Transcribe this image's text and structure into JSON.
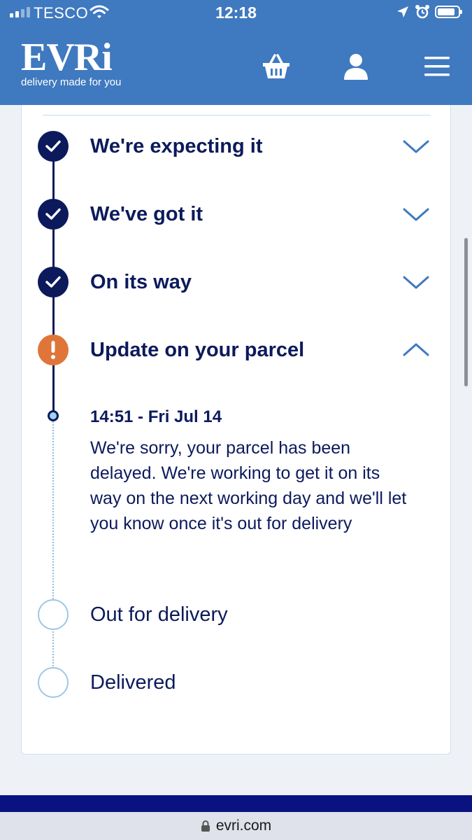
{
  "status_bar": {
    "carrier": "TESCO",
    "time": "12:18"
  },
  "header": {
    "logo": "EVRi",
    "tagline": "delivery made for you",
    "icons": [
      "basket-icon",
      "account-icon",
      "menu-icon"
    ]
  },
  "tracking": {
    "steps": [
      {
        "label": "We're expecting it",
        "state": "done",
        "expanded": false
      },
      {
        "label": "We've got it",
        "state": "done",
        "expanded": false
      },
      {
        "label": "On its way",
        "state": "done",
        "expanded": false
      },
      {
        "label": "Update on your parcel",
        "state": "alert",
        "expanded": true
      },
      {
        "label": "Out for delivery",
        "state": "pending"
      },
      {
        "label": "Delivered",
        "state": "pending"
      }
    ],
    "event": {
      "time": "14:51 - Fri Jul 14",
      "message": "We're sorry, your parcel has been delayed. We're working to get it on its way on the next working day and we'll let you know once it's out for delivery"
    }
  },
  "browser": {
    "url": "evri.com"
  },
  "colors": {
    "header_bg": "#3f79bf",
    "primary_navy": "#0c1a5c",
    "alert_orange": "#e0753a",
    "link_blue": "#3f79bf",
    "pending_ring": "#9dc7e6"
  }
}
